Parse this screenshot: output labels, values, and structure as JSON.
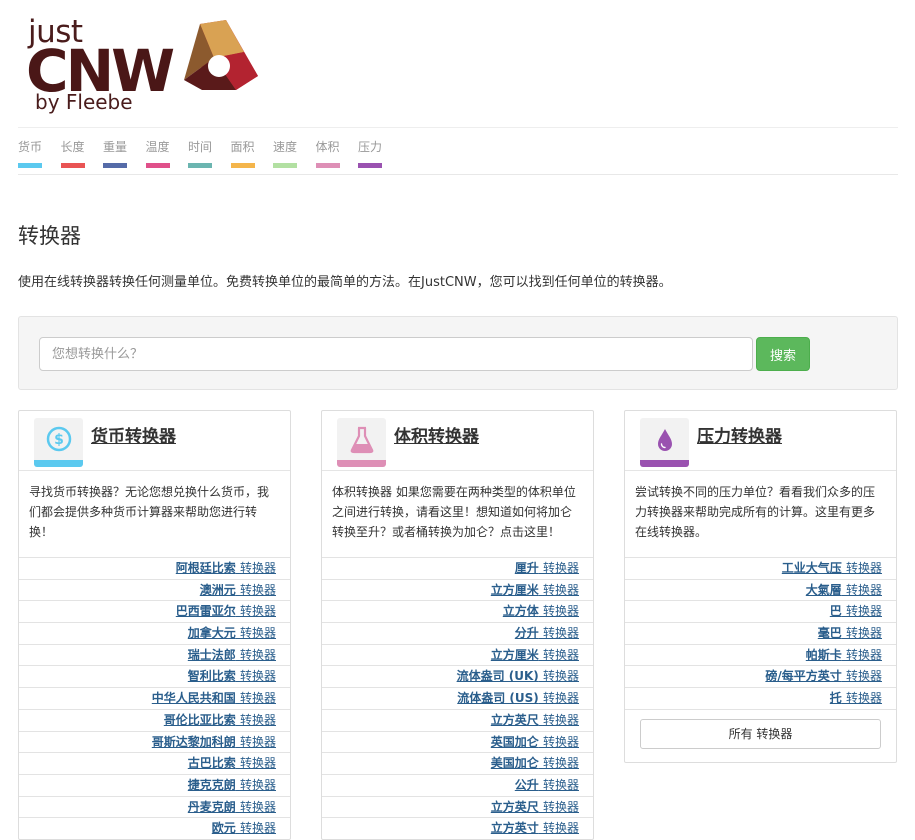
{
  "logo": {
    "just": "just",
    "cnw": "CNW",
    "by": "by Fleebe"
  },
  "nav": [
    {
      "label": "货币",
      "color": "#5bc9ef"
    },
    {
      "label": "长度",
      "color": "#e95454"
    },
    {
      "label": "重量",
      "color": "#556ba8"
    },
    {
      "label": "温度",
      "color": "#e0508a"
    },
    {
      "label": "时间",
      "color": "#6bb5b0"
    },
    {
      "label": "面积",
      "color": "#f4b54b"
    },
    {
      "label": "速度",
      "color": "#b2e0a2"
    },
    {
      "label": "体积",
      "color": "#de8fb6"
    },
    {
      "label": "压力",
      "color": "#9a52b0"
    }
  ],
  "page": {
    "title": "转换器",
    "description": "使用在线转换器转换任何测量单位。免费转换单位的最简单的方法。在JustCNW，您可以找到任何单位的转换器。"
  },
  "search": {
    "placeholder": "您想转换什么？",
    "button": "搜索"
  },
  "cards": [
    {
      "title": "货币转换器",
      "accent": "#5bc9ef",
      "icon": "currency-icon",
      "description": "寻找货币转换器？无论您想兑换什么货币，我们都会提供多种货币计算器来帮助您进行转换！",
      "items": [
        {
          "name": "阿根廷比索",
          "suffix": "转换器"
        },
        {
          "name": "澳洲元",
          "suffix": "转换器"
        },
        {
          "name": "巴西雷亚尔",
          "suffix": "转换器"
        },
        {
          "name": "加拿大元",
          "suffix": "转换器"
        },
        {
          "name": "瑞士法郎",
          "suffix": "转换器"
        },
        {
          "name": "智利比索",
          "suffix": "转换器"
        },
        {
          "name": "中华人民共和国",
          "suffix": "转换器"
        },
        {
          "name": "哥伦比亚比索",
          "suffix": "转换器"
        },
        {
          "name": "哥斯达黎加科朗",
          "suffix": "转换器"
        },
        {
          "name": "古巴比索",
          "suffix": "转换器"
        },
        {
          "name": "捷克克朗",
          "suffix": "转换器"
        },
        {
          "name": "丹麦克朗",
          "suffix": "转换器"
        },
        {
          "name": "欧元",
          "suffix": "转换器"
        }
      ]
    },
    {
      "title": "体积转换器",
      "accent": "#de8fb6",
      "icon": "flask-icon",
      "description": "体积转换器 如果您需要在两种类型的体积单位之间进行转换，请看这里！想知道如何将加仑转换至升？或者桶转换为加仑？点击这里！",
      "items": [
        {
          "name": "厘升",
          "suffix": "转换器"
        },
        {
          "name": "立方厘米",
          "suffix": "转换器"
        },
        {
          "name": "立方体",
          "suffix": "转换器"
        },
        {
          "name": "分升",
          "suffix": "转换器"
        },
        {
          "name": "立方厘米",
          "suffix": "转换器"
        },
        {
          "name": "流体盎司 (UK)",
          "suffix": "转换器"
        },
        {
          "name": "流体盎司 (US)",
          "suffix": "转换器"
        },
        {
          "name": "立方英尺",
          "suffix": "转换器"
        },
        {
          "name": "英国加仑",
          "suffix": "转换器"
        },
        {
          "name": "美国加仑",
          "suffix": "转换器"
        },
        {
          "name": "公升",
          "suffix": "转换器"
        },
        {
          "name": "立方英尺",
          "suffix": "转换器"
        },
        {
          "name": "立方英寸",
          "suffix": "转换器"
        }
      ]
    },
    {
      "title": "压力转换器",
      "accent": "#9a52b0",
      "icon": "drop-icon",
      "description": "尝试转换不同的压力单位？看看我们众多的压力转换器来帮助完成所有的计算。这里有更多在线转换器。",
      "items": [
        {
          "name": "工业大气压",
          "suffix": "转换器"
        },
        {
          "name": "大氣層",
          "suffix": "转换器"
        },
        {
          "name": "巴",
          "suffix": "转换器"
        },
        {
          "name": "毫巴",
          "suffix": "转换器"
        },
        {
          "name": "帕斯卡",
          "suffix": "转换器"
        },
        {
          "name": "磅/每平方英寸",
          "suffix": "转换器"
        },
        {
          "name": "托",
          "suffix": "转换器"
        }
      ],
      "footer_button": "所有 转换器"
    }
  ]
}
